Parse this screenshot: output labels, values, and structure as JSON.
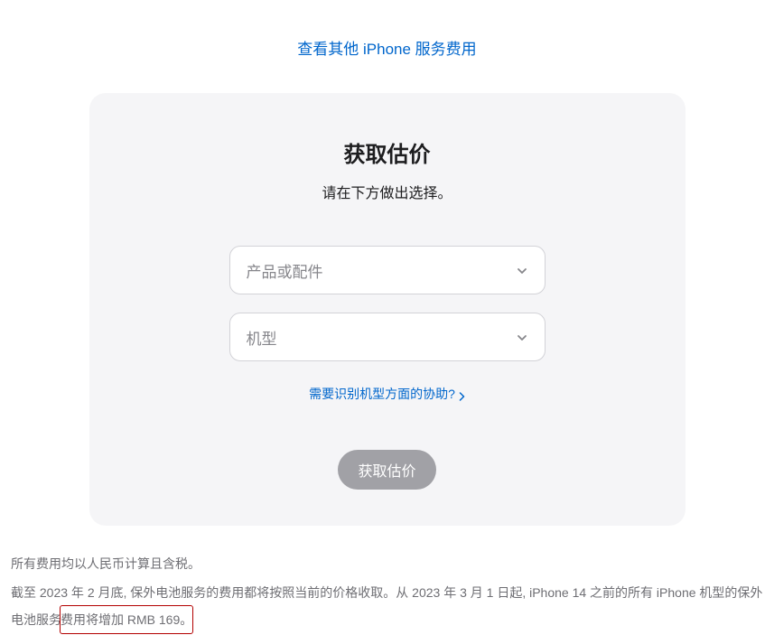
{
  "top_link": "查看其他 iPhone 服务费用",
  "card": {
    "title": "获取估价",
    "subtitle": "请在下方做出选择。",
    "select_product_placeholder": "产品或配件",
    "select_model_placeholder": "机型",
    "help_link": "需要识别机型方面的协助?",
    "submit_button": "获取估价"
  },
  "footer": {
    "line1": "所有费用均以人民币计算且含税。",
    "line2_prefix": "截至 2023 年 2 月底, 保外电池服务的费用都将按照当前的价格收取。从 2023 年 3 月 1 日起, iPhone 14 之前的所有 iPhone 机型的保外电池服务",
    "line2_highlight": "费用将增加 RMB 169。"
  }
}
